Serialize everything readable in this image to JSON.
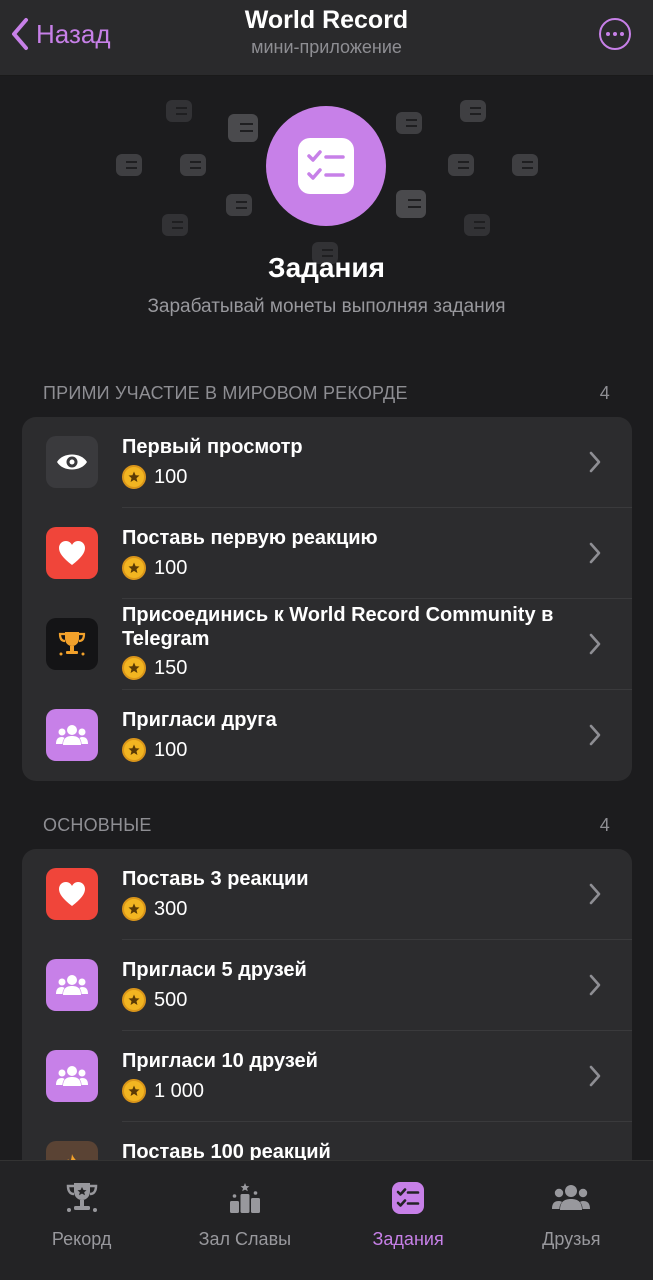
{
  "header": {
    "back_label": "Назад",
    "title": "World Record",
    "subtitle": "мини-приложение"
  },
  "hero": {
    "title": "Задания",
    "subtitle": "Зарабатывай монеты выполняя задания"
  },
  "sections": [
    {
      "title": "ПРИМИ УЧАСТИЕ В МИРОВОМ РЕКОРДЕ",
      "count": "4",
      "items": [
        {
          "name": "Первый просмотр",
          "reward": "100",
          "icon": "eye-icon"
        },
        {
          "name": "Поставь первую реакцию",
          "reward": "100",
          "icon": "heart-icon"
        },
        {
          "name": "Присоединись к World Record Community в Telegram",
          "reward": "150",
          "icon": "trophy-icon"
        },
        {
          "name": "Пригласи друга",
          "reward": "100",
          "icon": "people-icon"
        }
      ]
    },
    {
      "title": "ОСНОВНЫЕ",
      "count": "4",
      "items": [
        {
          "name": "Поставь 3 реакции",
          "reward": "300",
          "icon": "heart-icon"
        },
        {
          "name": "Пригласи 5 друзей",
          "reward": "500",
          "icon": "people-icon"
        },
        {
          "name": "Пригласи 10 друзей",
          "reward": "1 000",
          "icon": "people-icon"
        },
        {
          "name": "Поставь 100 реакций",
          "reward": "",
          "icon": "fire-icon"
        }
      ]
    }
  ],
  "nav": {
    "items": [
      {
        "label": "Рекорд",
        "icon": "trophy-icon",
        "active": false
      },
      {
        "label": "Зал Славы",
        "icon": "podium-icon",
        "active": false
      },
      {
        "label": "Задания",
        "icon": "checklist-icon",
        "active": true
      },
      {
        "label": "Друзья",
        "icon": "people-icon",
        "active": false
      }
    ]
  },
  "colors": {
    "accent": "#c780e8",
    "red": "#f0453a",
    "coin": "#f2b521",
    "background": "#1c1c1e",
    "card": "#2c2c2e"
  }
}
